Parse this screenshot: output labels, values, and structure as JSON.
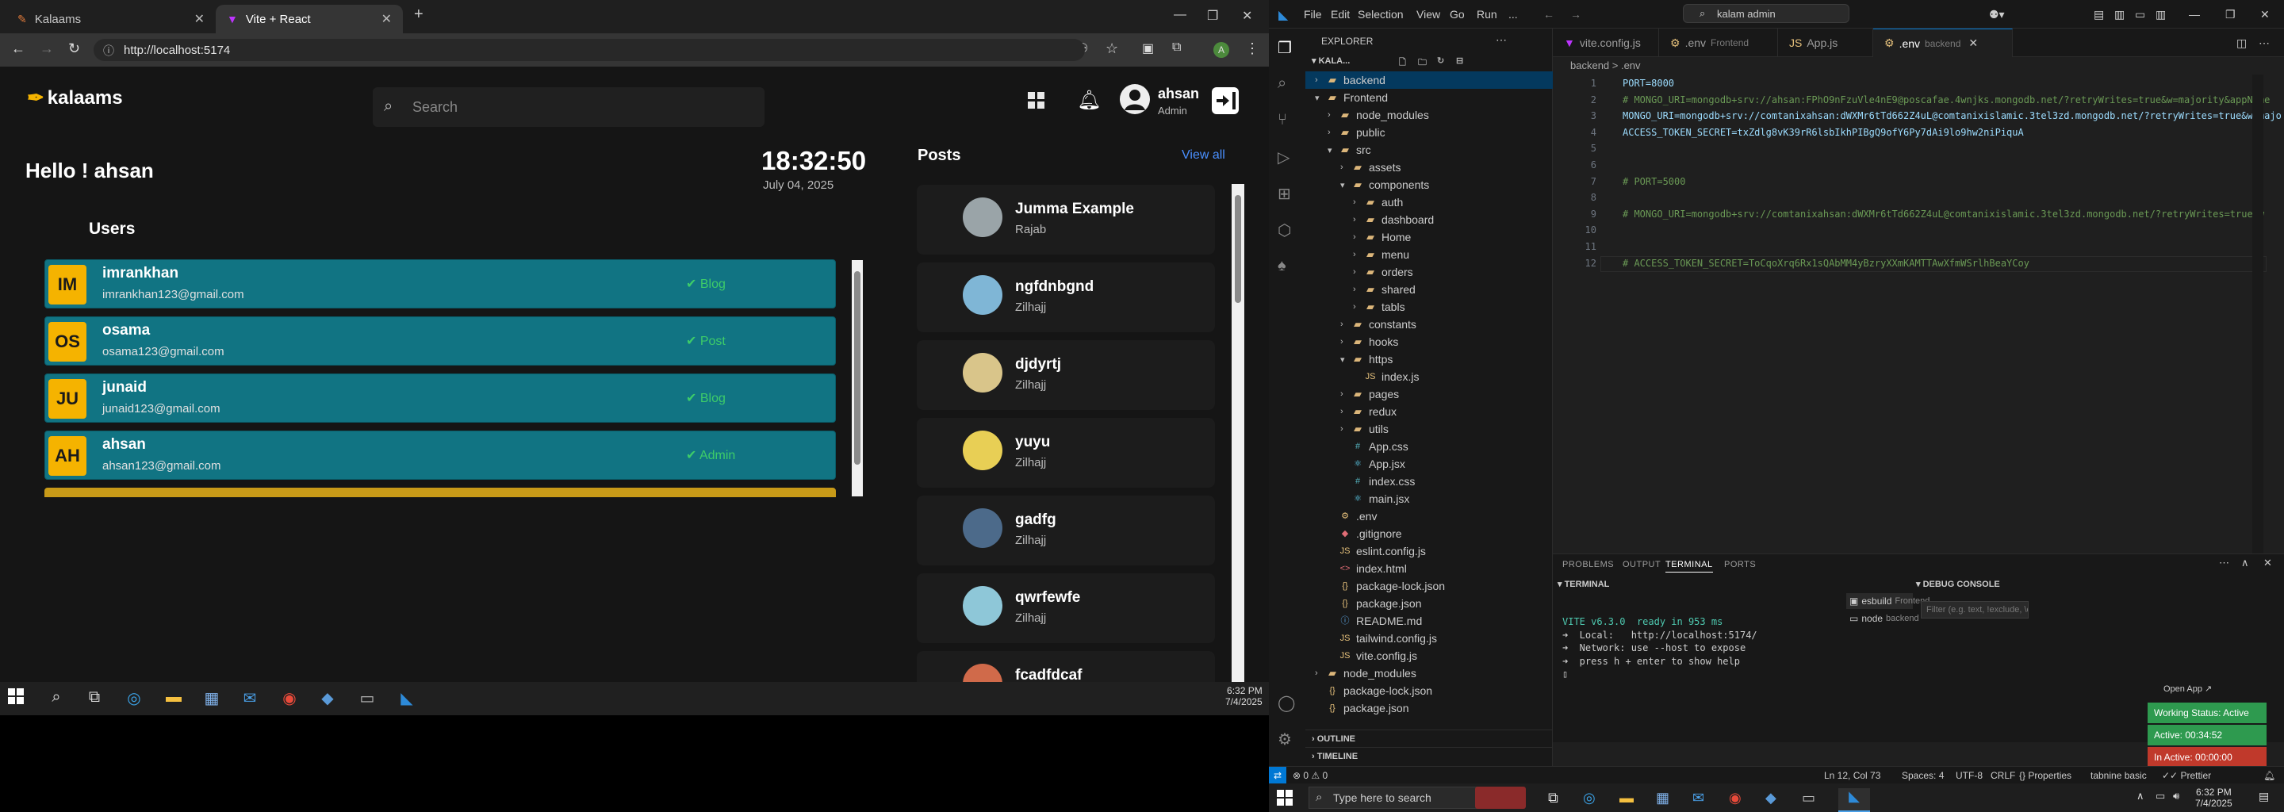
{
  "left_screen": {
    "browser": {
      "tabs": [
        {
          "title": "Kalaams",
          "active": false
        },
        {
          "title": "Vite + React",
          "active": true
        }
      ],
      "address": "http://localhost:5174"
    },
    "app": {
      "logo_text": "kalaams",
      "search_placeholder": "Search",
      "user_name": "ahsan",
      "user_role": "Admin",
      "greeting": "Hello ! ahsan",
      "time": "18:32:50",
      "date": "July 04, 2025",
      "users_heading": "Users",
      "users": [
        {
          "initials": "IM",
          "name": "imrankhan",
          "email": "imrankhan123@gmail.com",
          "role": "Blog"
        },
        {
          "initials": "OS",
          "name": "osama",
          "email": "osama123@gmail.com",
          "role": "Post"
        },
        {
          "initials": "JU",
          "name": "junaid",
          "email": "junaid123@gmail.com",
          "role": "Blog"
        },
        {
          "initials": "AH",
          "name": "ahsan",
          "email": "ahsan123@gmail.com",
          "role": "Admin"
        }
      ],
      "posts_heading": "Posts",
      "view_all": "View all",
      "posts": [
        {
          "title": "Jumma Example",
          "sub": "Rajab",
          "color": "#9aa4a8"
        },
        {
          "title": "ngfdnbgnd",
          "sub": "Zilhajj",
          "color": "#7fb6d6"
        },
        {
          "title": "djdyrtj",
          "sub": "Zilhajj",
          "color": "#d9c58a"
        },
        {
          "title": "yuyu",
          "sub": "Zilhajj",
          "color": "#e8cf55"
        },
        {
          "title": "gadfg",
          "sub": "Zilhajj",
          "color": "#4c6a8a"
        },
        {
          "title": "qwrfewfe",
          "sub": "Zilhajj",
          "color": "#8ec7d8"
        },
        {
          "title": "fcadfdcaf",
          "sub": "",
          "color": "#d06a4a"
        }
      ]
    },
    "taskbar": {
      "time": "6:32 PM",
      "date": "7/4/2025"
    }
  },
  "right_screen": {
    "title_menu": [
      "File",
      "Edit",
      "Selection",
      "View",
      "Go",
      "Run",
      "..."
    ],
    "command_center": "kalam admin",
    "explorer_label": "EXPLORER",
    "workspace": "KALA...",
    "tree": [
      {
        "d": 0,
        "t": "f",
        "n": "backend",
        "open": false
      },
      {
        "d": 0,
        "t": "f",
        "n": "Frontend",
        "open": true
      },
      {
        "d": 1,
        "t": "f",
        "n": "node_modules",
        "open": false
      },
      {
        "d": 1,
        "t": "f",
        "n": "public",
        "open": false
      },
      {
        "d": 1,
        "t": "f",
        "n": "src",
        "open": true
      },
      {
        "d": 2,
        "t": "f",
        "n": "assets",
        "open": false
      },
      {
        "d": 2,
        "t": "f",
        "n": "components",
        "open": true
      },
      {
        "d": 3,
        "t": "f",
        "n": "auth",
        "open": false
      },
      {
        "d": 3,
        "t": "f",
        "n": "dashboard",
        "open": false
      },
      {
        "d": 3,
        "t": "f",
        "n": "Home",
        "open": false
      },
      {
        "d": 3,
        "t": "f",
        "n": "menu",
        "open": false
      },
      {
        "d": 3,
        "t": "f",
        "n": "orders",
        "open": false
      },
      {
        "d": 3,
        "t": "f",
        "n": "shared",
        "open": false
      },
      {
        "d": 3,
        "t": "f",
        "n": "tabls",
        "open": false
      },
      {
        "d": 2,
        "t": "f",
        "n": "constants",
        "open": false
      },
      {
        "d": 2,
        "t": "f",
        "n": "hooks",
        "open": false
      },
      {
        "d": 2,
        "t": "f",
        "n": "https",
        "open": true
      },
      {
        "d": 3,
        "t": "js",
        "n": "index.js"
      },
      {
        "d": 2,
        "t": "f",
        "n": "pages",
        "open": false
      },
      {
        "d": 2,
        "t": "f",
        "n": "redux",
        "open": false
      },
      {
        "d": 2,
        "t": "f",
        "n": "utils",
        "open": false
      },
      {
        "d": 2,
        "t": "css",
        "n": "App.css"
      },
      {
        "d": 2,
        "t": "jsx",
        "n": "App.jsx"
      },
      {
        "d": 2,
        "t": "css",
        "n": "index.css"
      },
      {
        "d": 2,
        "t": "jsx",
        "n": "main.jsx"
      },
      {
        "d": 1,
        "t": "env",
        "n": ".env"
      },
      {
        "d": 1,
        "t": "git",
        "n": ".gitignore"
      },
      {
        "d": 1,
        "t": "js",
        "n": "eslint.config.js"
      },
      {
        "d": 1,
        "t": "html",
        "n": "index.html"
      },
      {
        "d": 1,
        "t": "json",
        "n": "package-lock.json"
      },
      {
        "d": 1,
        "t": "json",
        "n": "package.json"
      },
      {
        "d": 1,
        "t": "md",
        "n": "README.md"
      },
      {
        "d": 1,
        "t": "js",
        "n": "tailwind.config.js"
      },
      {
        "d": 1,
        "t": "js",
        "n": "vite.config.js"
      },
      {
        "d": 0,
        "t": "f",
        "n": "node_modules",
        "open": false
      },
      {
        "d": 0,
        "t": "json",
        "n": "package-lock.json"
      },
      {
        "d": 0,
        "t": "json",
        "n": "package.json"
      }
    ],
    "outline_label": "OUTLINE",
    "timeline_label": "TIMELINE",
    "editor_tabs": [
      {
        "name": "vite.config.js",
        "sub": ""
      },
      {
        "name": ".env",
        "sub": "Frontend"
      },
      {
        "name": "App.js",
        "sub": ""
      },
      {
        "name": ".env",
        "sub": "backend",
        "active": true
      }
    ],
    "breadcrumb": "backend > .env",
    "code": [
      {
        "n": "1",
        "k": "kv",
        "t": "PORT=8000"
      },
      {
        "n": "2",
        "k": "cm",
        "t": "# MONGO_URI=mongodb+srv://ahsan:FPhO9nFzuVle4nE9@poscafae.4wnjks.mongodb.net/?retryWrites=true&w=majority&appName"
      },
      {
        "n": "3",
        "k": "kv",
        "t": "MONGO_URI=mongodb+srv://comtanixahsan:dWXMr6tTd662Z4uL@comtanixislamic.3tel3zd.mongodb.net/?retryWrites=true&w=majo"
      },
      {
        "n": "4",
        "k": "kv",
        "t": "ACCESS_TOKEN_SECRET=txZdlg8vK39rR6lsbIkhPIBgQ9ofY6Py7dAi9lo9hw2niPiquA"
      },
      {
        "n": "5",
        "k": "kv",
        "t": ""
      },
      {
        "n": "6",
        "k": "kv",
        "t": ""
      },
      {
        "n": "7",
        "k": "cm",
        "t": "# PORT=5000"
      },
      {
        "n": "8",
        "k": "kv",
        "t": ""
      },
      {
        "n": "9",
        "k": "cm",
        "t": "# MONGO_URI=mongodb+srv://comtanixahsan:dWXMr6tTd662Z4uL@comtanixislamic.3tel3zd.mongodb.net/?retryWrites=true&w"
      },
      {
        "n": "10",
        "k": "kv",
        "t": ""
      },
      {
        "n": "11",
        "k": "kv",
        "t": ""
      },
      {
        "n": "12",
        "k": "cm",
        "t": "# ACCESS_TOKEN_SECRET=ToCqoXrq6Rx1sQAbMM4yBzryXXmKAMTTAwXfmWSrlhBeaYCoy"
      }
    ],
    "panel_tabs": [
      "PROBLEMS",
      "OUTPUT",
      "TERMINAL",
      "PORTS"
    ],
    "terminal_label": "TERMINAL",
    "terminal_lines": [
      "VITE v6.3.0  ready in 953 ms",
      "",
      "➜  Local:   http://localhost:5174/",
      "➜  Network: use --host to expose",
      "➜  press h + enter to show help"
    ],
    "terminals": [
      {
        "name": "esbuild",
        "sub": "Frontend"
      },
      {
        "name": "node",
        "sub": "backend"
      }
    ],
    "debug_console_label": "DEBUG CONSOLE",
    "debug_filter_placeholder": "Filter (e.g. text, !exclude, \\escape)",
    "open_app": "Open App ↗",
    "working_status": "Working Status: Active",
    "active_time": "Active: 00:34:52",
    "inactive_time": "In Active: 00:00:00",
    "status": {
      "errors": "0",
      "warnings": "0",
      "position": "Ln 12, Col 73",
      "spaces": "Spaces: 4",
      "encoding": "UTF-8",
      "eol": "CRLF",
      "properties": "Properties",
      "tabnine": "tabnine basic",
      "prettier": "Prettier"
    },
    "taskbar_search": "Type here to search",
    "taskbar_time": "6:32 PM",
    "taskbar_date": "7/4/2025"
  }
}
